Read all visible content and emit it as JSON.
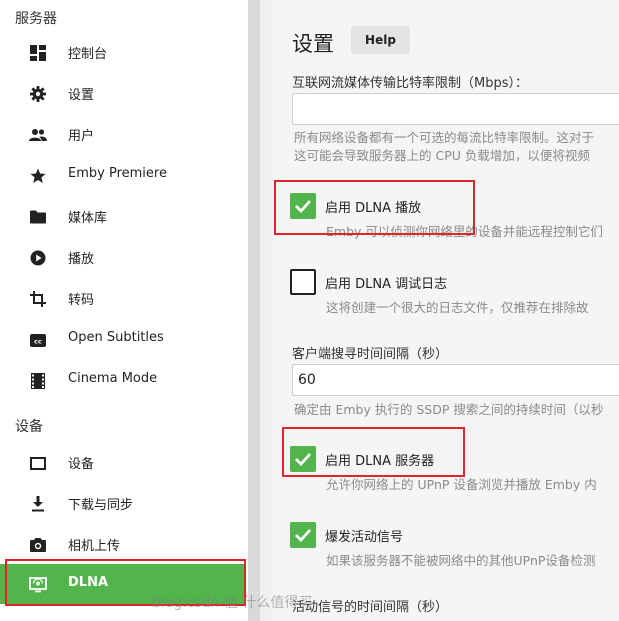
{
  "sidebar": {
    "server_section": "服务器",
    "device_section": "设备",
    "server_items": [
      {
        "label": "控制台",
        "icon": "dashboard-icon"
      },
      {
        "label": "设置",
        "icon": "gear-icon"
      },
      {
        "label": "用户",
        "icon": "people-icon"
      },
      {
        "label": "Emby Premiere",
        "icon": "star-icon"
      },
      {
        "label": "媒体库",
        "icon": "folder-icon"
      },
      {
        "label": "播放",
        "icon": "play-circle-icon"
      },
      {
        "label": "转码",
        "icon": "crop-icon"
      },
      {
        "label": "Open Subtitles",
        "icon": "closed-caption-icon"
      },
      {
        "label": "Cinema Mode",
        "icon": "film-icon"
      }
    ],
    "device_items": [
      {
        "label": "设备",
        "icon": "tv-icon"
      },
      {
        "label": "下载与同步",
        "icon": "download-icon"
      },
      {
        "label": "相机上传",
        "icon": "camera-icon"
      },
      {
        "label": "DLNA",
        "icon": "dlna-icon"
      }
    ],
    "active_color": "#52b54b"
  },
  "main": {
    "title": "设置",
    "help_label": "Help",
    "bitrate_label": "互联网流媒体传输比特率限制（Mbps）：",
    "bitrate_value": "",
    "bitrate_help_1": "所有网络设备都有一个可选的每流比特率限制。这对于",
    "bitrate_help_2": "这可能会导致服务器上的 CPU 负载增加，以便将视频",
    "dlna_play_label": "启用 DLNA 播放",
    "dlna_play_checked": true,
    "dlna_play_help": "Emby 可以侦测你网络里的设备并能远程控制它们",
    "dlna_debug_label": "启用 DLNA 调试日志",
    "dlna_debug_checked": false,
    "dlna_debug_help": "这将创建一个很大的日志文件，仅推荐在排除故",
    "discovery_label": "客户端搜寻时间间隔（秒）",
    "discovery_value": "60",
    "discovery_help": "确定由 Emby 执行的 SSDP 搜索之间的持续时间（以秒",
    "dlna_server_label": "启用 DLNA 服务器",
    "dlna_server_checked": true,
    "dlna_server_help": "允许你网络上的 UPnP 设备浏览并播放 Emby 内",
    "blast_label": "爆发活动信号",
    "blast_checked": true,
    "blast_help": "如果该服务器不能被网络中的其他UPnP设备检测",
    "alive_interval_label": "活动信号的时间间隔（秒）"
  },
  "watermark": "blog.csdn  值 什么值得买",
  "colors": {
    "accent": "#52b54b",
    "highlight": "#e0262d"
  }
}
